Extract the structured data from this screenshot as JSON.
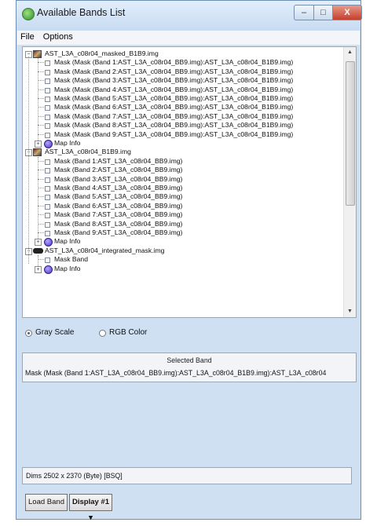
{
  "window": {
    "title": "Available Bands List",
    "icon": "globe-icon"
  },
  "titlebar_buttons": {
    "minimize": "–",
    "maximize": "□",
    "close": "X"
  },
  "menu": [
    "File",
    "Options"
  ],
  "tree": {
    "files": [
      {
        "name": "AST_L3A_c08r04_masked_B1B9.img",
        "icon": "image-file-icon",
        "bands": [
          "Mask (Mask (Band 1:AST_L3A_c08r04_BB9.img):AST_L3A_c08r04_B1B9.img)",
          "Mask (Mask (Band 2:AST_L3A_c08r04_BB9.img):AST_L3A_c08r04_B1B9.img)",
          "Mask (Mask (Band 3:AST_L3A_c08r04_BB9.img):AST_L3A_c08r04_B1B9.img)",
          "Mask (Mask (Band 4:AST_L3A_c08r04_BB9.img):AST_L3A_c08r04_B1B9.img)",
          "Mask (Mask (Band 5:AST_L3A_c08r04_BB9.img):AST_L3A_c08r04_B1B9.img)",
          "Mask (Mask (Band 6:AST_L3A_c08r04_BB9.img):AST_L3A_c08r04_B1B9.img)",
          "Mask (Mask (Band 7:AST_L3A_c08r04_BB9.img):AST_L3A_c08r04_B1B9.img)",
          "Mask (Mask (Band 8:AST_L3A_c08r04_BB9.img):AST_L3A_c08r04_B1B9.img)",
          "Mask (Mask (Band 9:AST_L3A_c08r04_BB9.img):AST_L3A_c08r04_B1B9.img)"
        ],
        "map_info": "Map Info"
      },
      {
        "name": "AST_L3A_c08r04_B1B9.img",
        "icon": "image-file-icon",
        "bands": [
          "Mask (Band 1:AST_L3A_c08r04_BB9.img)",
          "Mask (Band 2:AST_L3A_c08r04_BB9.img)",
          "Mask (Band 3:AST_L3A_c08r04_BB9.img)",
          "Mask (Band 4:AST_L3A_c08r04_BB9.img)",
          "Mask (Band 5:AST_L3A_c08r04_BB9.img)",
          "Mask (Band 6:AST_L3A_c08r04_BB9.img)",
          "Mask (Band 7:AST_L3A_c08r04_BB9.img)",
          "Mask (Band 8:AST_L3A_c08r04_BB9.img)",
          "Mask (Band 9:AST_L3A_c08r04_BB9.img)"
        ],
        "map_info": "Map Info"
      },
      {
        "name": "AST_L3A_c08r04_integrated_mask.img",
        "icon": "mask-file-icon",
        "bands": [
          "Mask Band"
        ],
        "map_info": "Map Info"
      }
    ]
  },
  "radio": {
    "gray": "Gray Scale",
    "rgb": "RGB Color",
    "selected": "gray"
  },
  "selected_band": {
    "title": "Selected Band",
    "value": "Mask (Mask (Band 1:AST_L3A_c08r04_BB9.img):AST_L3A_c08r04_B1B9.img):AST_L3A_c08r04"
  },
  "dims": "Dims 2502 x 2370 (Byte) [BSQ]",
  "buttons": {
    "load": "Load Band",
    "display": "Display #1 ▾"
  }
}
